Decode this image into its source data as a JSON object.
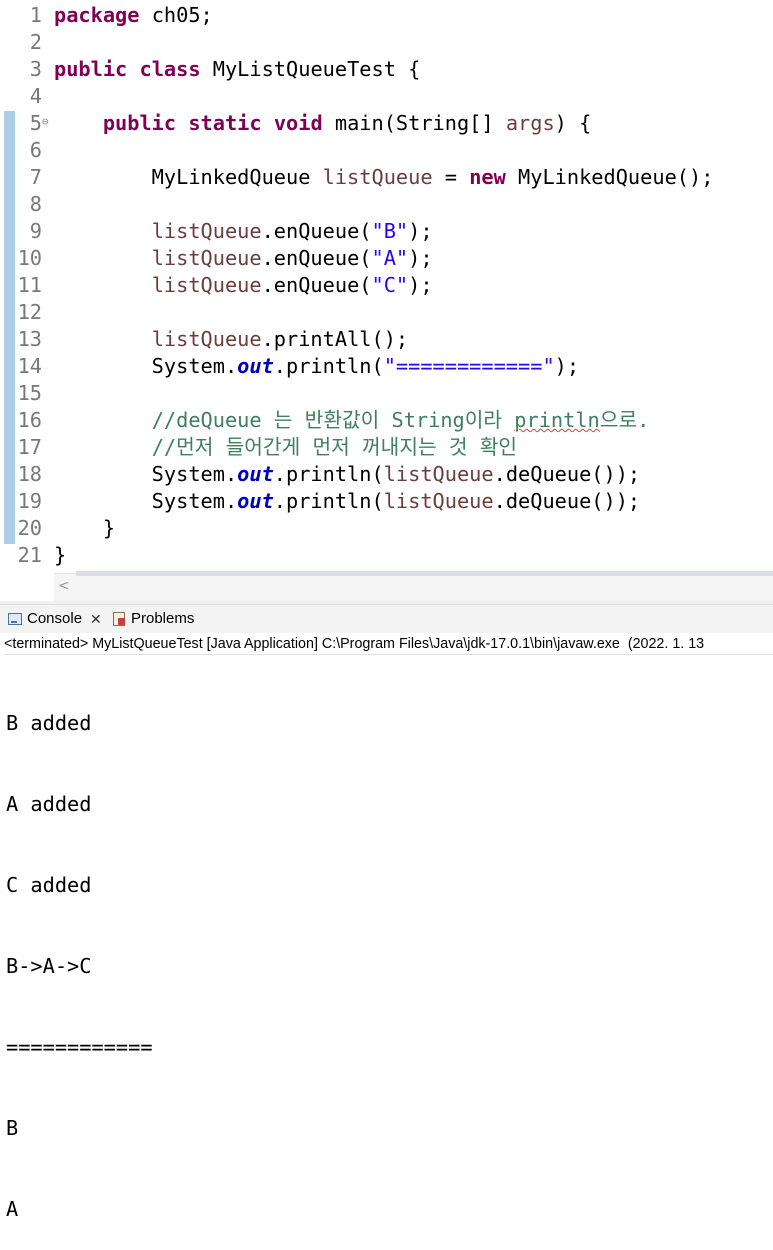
{
  "editor": {
    "lines": [
      {
        "n": "1",
        "tokens": [
          {
            "t": "package",
            "c": "kw"
          },
          {
            "t": " ch05;",
            "c": ""
          }
        ]
      },
      {
        "n": "2",
        "tokens": []
      },
      {
        "n": "3",
        "tokens": [
          {
            "t": "public",
            "c": "kw"
          },
          {
            "t": " ",
            "c": ""
          },
          {
            "t": "class",
            "c": "kw"
          },
          {
            "t": " MyListQueueTest {",
            "c": ""
          }
        ]
      },
      {
        "n": "4",
        "tokens": []
      },
      {
        "n": "5",
        "fold": true,
        "tokens": [
          {
            "t": "    ",
            "c": ""
          },
          {
            "t": "public",
            "c": "kw"
          },
          {
            "t": " ",
            "c": ""
          },
          {
            "t": "static",
            "c": "kw"
          },
          {
            "t": " ",
            "c": ""
          },
          {
            "t": "void",
            "c": "kw"
          },
          {
            "t": " main(String[] ",
            "c": ""
          },
          {
            "t": "args",
            "c": "var"
          },
          {
            "t": ") {",
            "c": ""
          }
        ]
      },
      {
        "n": "6",
        "tokens": []
      },
      {
        "n": "7",
        "tokens": [
          {
            "t": "        MyLinkedQueue ",
            "c": ""
          },
          {
            "t": "listQueue",
            "c": "var"
          },
          {
            "t": " = ",
            "c": ""
          },
          {
            "t": "new",
            "c": "kw"
          },
          {
            "t": " MyLinkedQueue();",
            "c": ""
          }
        ]
      },
      {
        "n": "8",
        "tokens": []
      },
      {
        "n": "9",
        "tokens": [
          {
            "t": "        ",
            "c": ""
          },
          {
            "t": "listQueue",
            "c": "var"
          },
          {
            "t": ".enQueue(",
            "c": ""
          },
          {
            "t": "\"B\"",
            "c": "str"
          },
          {
            "t": ");",
            "c": ""
          }
        ]
      },
      {
        "n": "10",
        "tokens": [
          {
            "t": "        ",
            "c": ""
          },
          {
            "t": "listQueue",
            "c": "var"
          },
          {
            "t": ".enQueue(",
            "c": ""
          },
          {
            "t": "\"A\"",
            "c": "str"
          },
          {
            "t": ");",
            "c": ""
          }
        ]
      },
      {
        "n": "11",
        "tokens": [
          {
            "t": "        ",
            "c": ""
          },
          {
            "t": "listQueue",
            "c": "var"
          },
          {
            "t": ".enQueue(",
            "c": ""
          },
          {
            "t": "\"C\"",
            "c": "str"
          },
          {
            "t": ");",
            "c": ""
          }
        ]
      },
      {
        "n": "12",
        "tokens": []
      },
      {
        "n": "13",
        "tokens": [
          {
            "t": "        ",
            "c": ""
          },
          {
            "t": "listQueue",
            "c": "var"
          },
          {
            "t": ".printAll();",
            "c": ""
          }
        ]
      },
      {
        "n": "14",
        "tokens": [
          {
            "t": "        System.",
            "c": ""
          },
          {
            "t": "out",
            "c": "fld"
          },
          {
            "t": ".println(",
            "c": ""
          },
          {
            "t": "\"============\"",
            "c": "str"
          },
          {
            "t": ");",
            "c": ""
          }
        ]
      },
      {
        "n": "15",
        "tokens": []
      },
      {
        "n": "16",
        "tokens": [
          {
            "t": "        ",
            "c": ""
          },
          {
            "t": "//deQueue 는 반환값이 String이라 ",
            "c": "cmt"
          },
          {
            "t": "println",
            "c": "cmt err"
          },
          {
            "t": "으로.",
            "c": "cmt"
          }
        ]
      },
      {
        "n": "17",
        "tokens": [
          {
            "t": "        ",
            "c": ""
          },
          {
            "t": "//먼저 들어간게 먼저 꺼내지는 것 확인",
            "c": "cmt"
          }
        ]
      },
      {
        "n": "18",
        "tokens": [
          {
            "t": "        System.",
            "c": ""
          },
          {
            "t": "out",
            "c": "fld"
          },
          {
            "t": ".println(",
            "c": ""
          },
          {
            "t": "listQueue",
            "c": "var"
          },
          {
            "t": ".deQueue());",
            "c": ""
          }
        ]
      },
      {
        "n": "19",
        "tokens": [
          {
            "t": "        System.",
            "c": ""
          },
          {
            "t": "out",
            "c": "fld"
          },
          {
            "t": ".println(",
            "c": ""
          },
          {
            "t": "listQueue",
            "c": "var"
          },
          {
            "t": ".deQueue());",
            "c": ""
          }
        ]
      },
      {
        "n": "20",
        "tokens": [
          {
            "t": "    }",
            "c": ""
          }
        ]
      },
      {
        "n": "21",
        "tokens": [
          {
            "t": "}",
            "c": ""
          }
        ]
      }
    ]
  },
  "console_panel": {
    "tabs": [
      {
        "label": "Console",
        "icon": "console-icon",
        "closable": true
      },
      {
        "label": "Problems",
        "icon": "problems-icon",
        "closable": false
      }
    ],
    "status": "<terminated> MyListQueueTest [Java Application] C:\\Program Files\\Java\\jdk-17.0.1\\bin\\javaw.exe  (2022. 1. 13",
    "output": [
      "B added",
      "A added",
      "C added",
      "B->A->C",
      "============",
      "B",
      "A"
    ]
  }
}
